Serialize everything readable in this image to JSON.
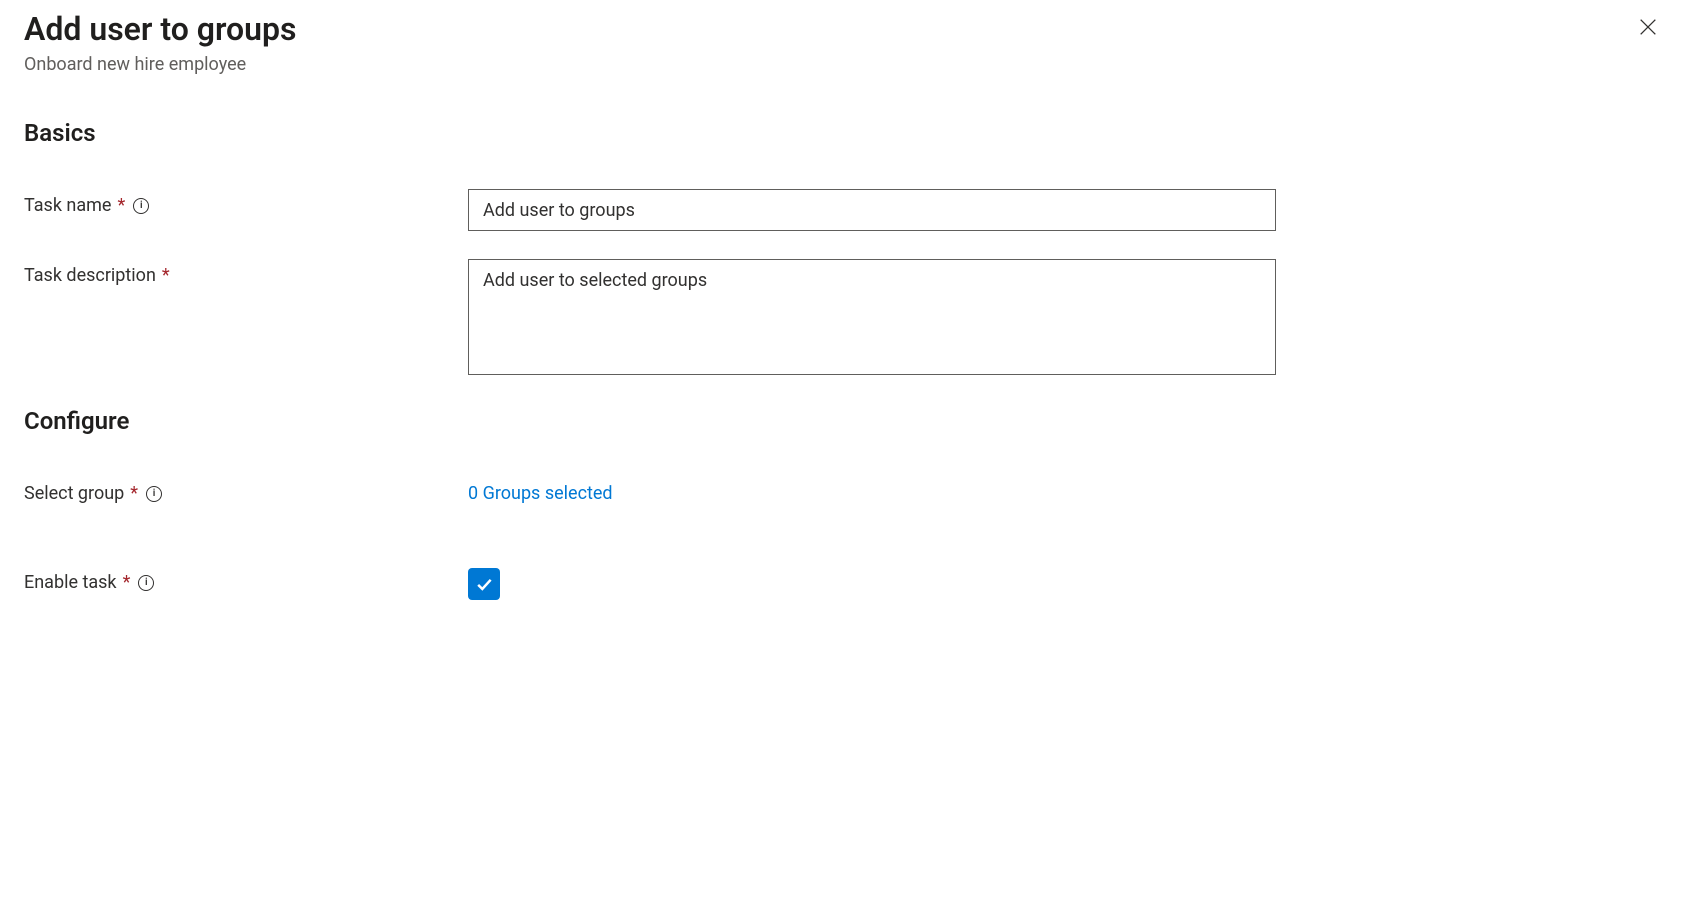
{
  "header": {
    "title": "Add user to groups",
    "subtitle": "Onboard new hire employee"
  },
  "sections": {
    "basics": {
      "title": "Basics",
      "task_name": {
        "label": "Task name",
        "value": "Add user to groups"
      },
      "task_description": {
        "label": "Task description",
        "value": "Add user to selected groups"
      }
    },
    "configure": {
      "title": "Configure",
      "select_group": {
        "label": "Select group",
        "link_text": "0 Groups selected"
      },
      "enable_task": {
        "label": "Enable task",
        "checked": true
      }
    }
  }
}
